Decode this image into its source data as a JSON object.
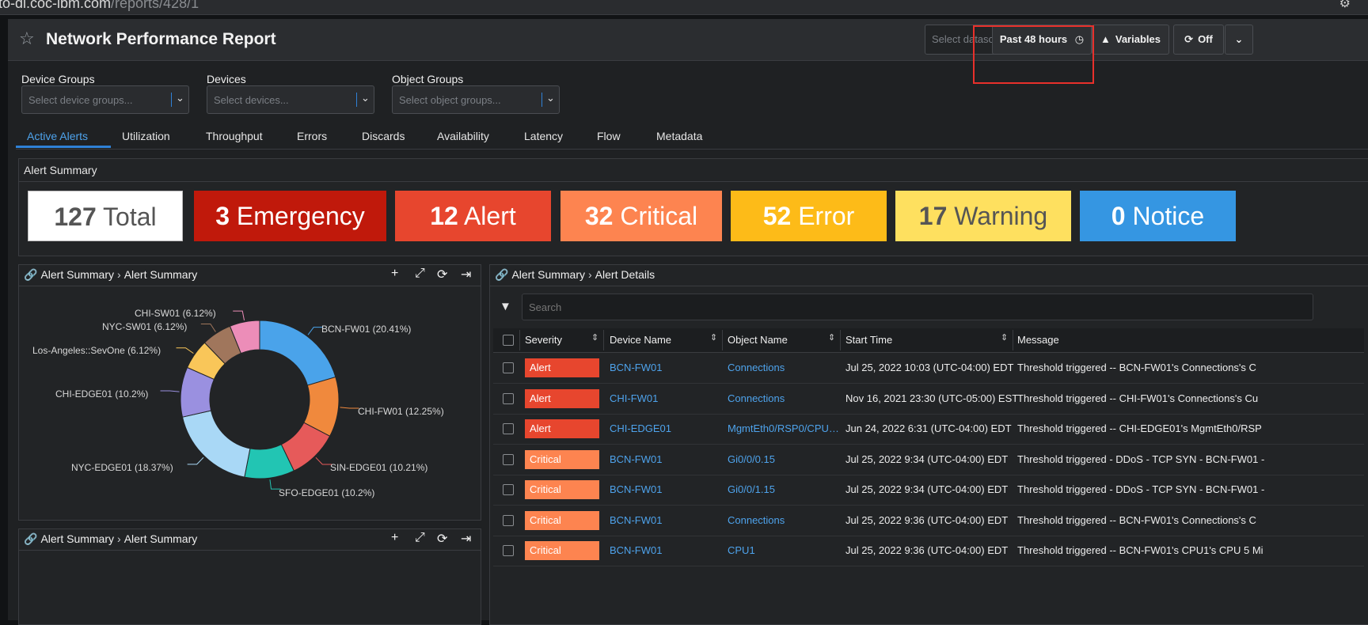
{
  "browser": {
    "url_prefix": "to-di.coc-ibm.com",
    "url_path": "/reports/428/1"
  },
  "header": {
    "title": "Network Performance Report",
    "datasource_placeholder": "Select datasource...",
    "time_range_label": "Past 48 hours",
    "variables_label": "Variables",
    "refresh_label": "Off"
  },
  "filters": [
    {
      "label": "Device Groups",
      "placeholder": "Select device groups..."
    },
    {
      "label": "Devices",
      "placeholder": "Select devices..."
    },
    {
      "label": "Object Groups",
      "placeholder": "Select object groups..."
    }
  ],
  "tabs": [
    "Active Alerts",
    "Utilization",
    "Throughput",
    "Errors",
    "Discards",
    "Availability",
    "Latency",
    "Flow",
    "Metadata"
  ],
  "active_tab": "Active Alerts",
  "alert_summary": {
    "title": "Alert Summary",
    "boxes": [
      {
        "count": "127",
        "label": "Total",
        "color": "#ffffff",
        "text_color": "#555555"
      },
      {
        "count": "3",
        "label": "Emergency",
        "color": "#c0190b",
        "text_color": "#ffffff"
      },
      {
        "count": "12",
        "label": "Alert",
        "color": "#e7462e",
        "text_color": "#ffffff"
      },
      {
        "count": "32",
        "label": "Critical",
        "color": "#fd8450",
        "text_color": "#ffffff"
      },
      {
        "count": "52",
        "label": "Error",
        "color": "#fdbb18",
        "text_color": "#ffffff"
      },
      {
        "count": "17",
        "label": "Warning",
        "color": "#fee05f",
        "text_color": "#555555"
      },
      {
        "count": "0",
        "label": "Notice",
        "color": "#3596e2",
        "text_color": "#ffffff"
      }
    ]
  },
  "chart_panel": {
    "breadcrumb_1": "Alert Summary",
    "breadcrumb_2": "Alert Summary"
  },
  "bottom_panel": {
    "breadcrumb_1": "Alert Summary",
    "breadcrumb_2": "Alert Summary"
  },
  "chart_data": {
    "type": "pie",
    "title": "",
    "labels": [
      "BCN-FW01 (20.41%)",
      "CHI-FW01 (12.25%)",
      "SIN-EDGE01 (10.21%)",
      "SFO-EDGE01 (10.2%)",
      "NYC-EDGE01 (18.37%)",
      "CHI-EDGE01 (10.2%)",
      "Los-Angeles::SevOne (6.12%)",
      "NYC-SW01 (6.12%)",
      "CHI-SW01 (6.12%)"
    ],
    "values": [
      20.41,
      12.25,
      10.21,
      10.2,
      18.37,
      10.2,
      6.12,
      6.12,
      6.12
    ],
    "colors": [
      "#4aa3ea",
      "#f0893d",
      "#e65a5a",
      "#22c5b3",
      "#a9d8f6",
      "#9a90e0",
      "#f9c659",
      "#a0765c",
      "#ec8db8"
    ],
    "donut": true
  },
  "details_panel": {
    "breadcrumb_1": "Alert Summary",
    "breadcrumb_2": "Alert Details",
    "search_placeholder": "Search",
    "columns": [
      "Severity",
      "Device Name",
      "Object Name",
      "Start Time",
      "Message"
    ],
    "rows": [
      {
        "severity": "Alert",
        "sev_color": "#e7462e",
        "device": "BCN-FW01",
        "object": "Connections",
        "start": "Jul 25, 2022 10:03 (UTC-04:00) EDT",
        "message": "Threshold triggered -- BCN-FW01's Connections's C"
      },
      {
        "severity": "Alert",
        "sev_color": "#e7462e",
        "device": "CHI-FW01",
        "object": "Connections",
        "start": "Nov 16, 2021 23:30 (UTC-05:00) EST",
        "message": "Threshold triggered -- CHI-FW01's Connections's Cu"
      },
      {
        "severity": "Alert",
        "sev_color": "#e7462e",
        "device": "CHI-EDGE01",
        "object": "MgmtEth0/RSP0/CPU…",
        "start": "Jun 24, 2022 6:31 (UTC-04:00) EDT",
        "message": "Threshold triggered -- CHI-EDGE01's MgmtEth0/RSP"
      },
      {
        "severity": "Critical",
        "sev_color": "#fd8450",
        "device": "BCN-FW01",
        "object": "Gi0/0/0.15",
        "start": "Jul 25, 2022 9:34 (UTC-04:00) EDT",
        "message": "Threshold triggered - DDoS - TCP SYN - BCN-FW01 -"
      },
      {
        "severity": "Critical",
        "sev_color": "#fd8450",
        "device": "BCN-FW01",
        "object": "Gi0/0/1.15",
        "start": "Jul 25, 2022 9:34 (UTC-04:00) EDT",
        "message": "Threshold triggered - DDoS - TCP SYN - BCN-FW01 -"
      },
      {
        "severity": "Critical",
        "sev_color": "#fd8450",
        "device": "BCN-FW01",
        "object": "Connections",
        "start": "Jul 25, 2022 9:36 (UTC-04:00) EDT",
        "message": "Threshold triggered -- BCN-FW01's Connections's C"
      },
      {
        "severity": "Critical",
        "sev_color": "#fd8450",
        "device": "BCN-FW01",
        "object": "CPU1",
        "start": "Jul 25, 2022 9:36 (UTC-04:00) EDT",
        "message": "Threshold triggered -- BCN-FW01's CPU1's CPU 5 Mi"
      }
    ]
  }
}
